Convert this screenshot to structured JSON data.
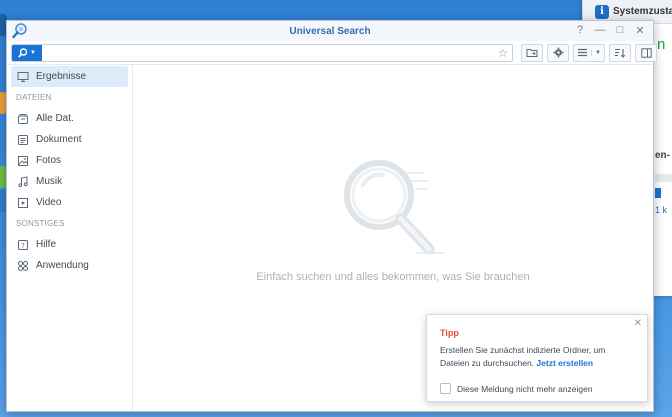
{
  "window": {
    "title": "Universal Search",
    "controls": [
      "?",
      "—",
      "□",
      "✕"
    ]
  },
  "search": {
    "value": "",
    "placeholder": ""
  },
  "sidebar": {
    "items": [
      {
        "label": "Ergebnisse",
        "icon": "monitor-icon",
        "active": true
      }
    ],
    "sections": [
      {
        "title": "DATEIEN",
        "items": [
          {
            "label": "Alle Dat.",
            "icon": "files-icon"
          },
          {
            "label": "Dokument",
            "icon": "document-icon"
          },
          {
            "label": "Fotos",
            "icon": "photo-icon"
          },
          {
            "label": "Musik",
            "icon": "music-icon"
          },
          {
            "label": "Video",
            "icon": "video-icon"
          }
        ]
      },
      {
        "title": "SONSTIGES",
        "items": [
          {
            "label": "Hilfe",
            "icon": "help-icon"
          },
          {
            "label": "Anwendung",
            "icon": "apps-icon"
          }
        ]
      }
    ]
  },
  "main": {
    "empty_message": "Einfach suchen und alles bekommen, was Sie brauchen"
  },
  "tip": {
    "title": "Tipp",
    "body": "Erstellen Sie zunächst indizierte Ordner, um Dateien zu durchsuchen.",
    "link": "Jetzt erstellen",
    "checkbox_label": "Diese Meldung nicht mehr anzeigen",
    "checked": false
  },
  "background_window": {
    "title": "Systemzusta",
    "status_fragment": "n",
    "sub_fragment": "en-",
    "link_fragment": "1 k"
  },
  "colors": {
    "accent": "#1a73d9",
    "title": "#2d6eb5",
    "tip_title": "#e64c3c",
    "active_bg": "#dcecfb",
    "status_green": "#1aa34a"
  }
}
